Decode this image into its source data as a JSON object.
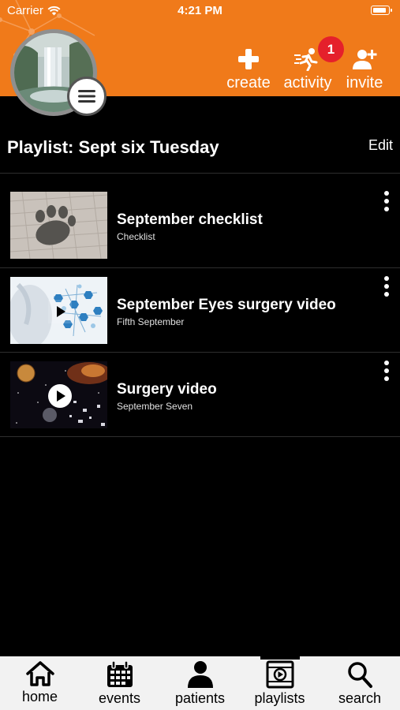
{
  "status_bar": {
    "carrier": "Carrier",
    "time": "4:21 PM"
  },
  "header": {
    "actions": [
      {
        "label": "create",
        "icon": "plus-icon"
      },
      {
        "label": "activity",
        "icon": "running-person-icon"
      },
      {
        "label": "invite",
        "icon": "add-person-icon"
      }
    ],
    "activity_badge": "1",
    "accent_color": "#f07a1a"
  },
  "playlist": {
    "title": "Playlist:  Sept six Tuesday",
    "edit_label": "Edit",
    "items": [
      {
        "title": "September checklist",
        "subtitle": "Checklist",
        "type": "checklist"
      },
      {
        "title": "September  Eyes surgery video",
        "subtitle": "Fifth September",
        "type": "video"
      },
      {
        "title": "Surgery video",
        "subtitle": "September Seven",
        "type": "video"
      }
    ]
  },
  "tabbar": {
    "tabs": [
      {
        "label": "home",
        "icon": "home-icon"
      },
      {
        "label": "events",
        "icon": "calendar-icon"
      },
      {
        "label": "patients",
        "icon": "person-icon"
      },
      {
        "label": "playlists",
        "icon": "playlist-icon"
      },
      {
        "label": "search",
        "icon": "search-icon"
      }
    ],
    "active": "playlists"
  }
}
